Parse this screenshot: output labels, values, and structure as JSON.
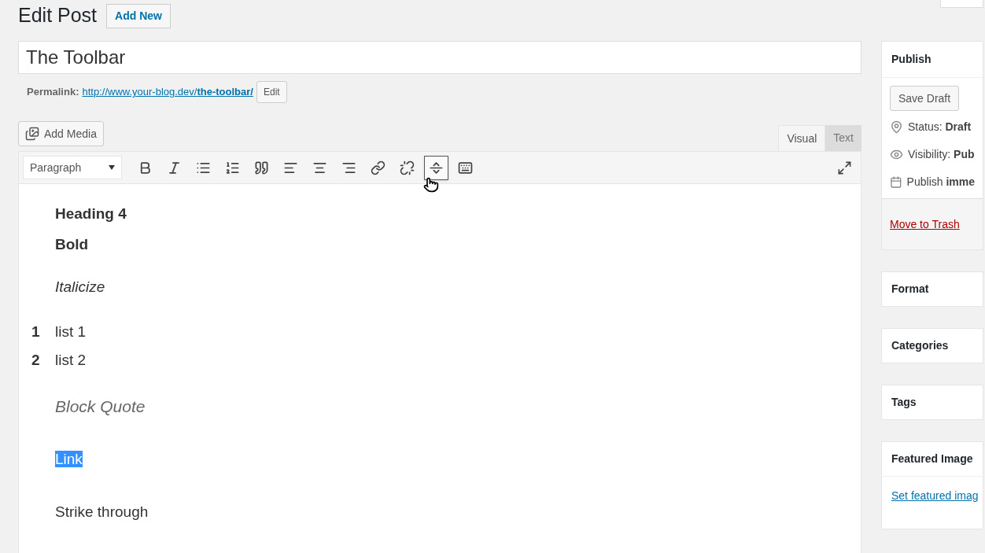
{
  "header": {
    "title": "Edit Post",
    "add_new": "Add New"
  },
  "post_title": "The Toolbar",
  "permalink": {
    "label": "Permalink:",
    "url_base": "http://www.your-blog.dev/",
    "slug": "the-toolbar/",
    "edit": "Edit"
  },
  "add_media": "Add Media",
  "editor_tabs": [
    {
      "label": "Visual",
      "selected": true
    },
    {
      "label": "Text",
      "selected": false
    }
  ],
  "format_select": "Paragraph",
  "toolbar_buttons": [
    {
      "kind": "bold",
      "selected": false
    },
    {
      "kind": "italic",
      "selected": false
    },
    {
      "kind": "bullets",
      "selected": false
    },
    {
      "kind": "numbers",
      "selected": false
    },
    {
      "kind": "quote",
      "selected": false
    },
    {
      "kind": "align-left",
      "selected": false
    },
    {
      "kind": "align-center",
      "selected": false
    },
    {
      "kind": "align-right",
      "selected": false
    },
    {
      "kind": "link",
      "selected": false
    },
    {
      "kind": "unlink",
      "selected": false
    },
    {
      "kind": "more",
      "selected": true
    },
    {
      "kind": "toolbar-toggle",
      "selected": false
    }
  ],
  "content": [
    {
      "kind": "heading",
      "text": "Heading 4"
    },
    {
      "kind": "bold",
      "text": "Bold"
    },
    {
      "kind": "italic",
      "text": "Italicize"
    },
    {
      "kind": "list",
      "items": [
        {
          "number": "1",
          "text": "list 1"
        },
        {
          "number": "2",
          "text": "list 2"
        }
      ]
    },
    {
      "kind": "quote",
      "text": "Block Quote"
    },
    {
      "kind": "selected",
      "text": "Link"
    },
    {
      "kind": "plain",
      "text": "Strike through"
    }
  ],
  "sidebar": {
    "publish": {
      "title": "Publish",
      "save_draft": "Save Draft",
      "rows": [
        {
          "kind": "status",
          "text": "Status: **Draft**"
        },
        {
          "kind": "visibility",
          "text": "Visibility: **Pub**"
        },
        {
          "kind": "schedule",
          "text": "Publish **imme**"
        }
      ],
      "trash": "Move to Trash"
    },
    "boxes": [
      {
        "title": "Format"
      },
      {
        "title": "Categories"
      },
      {
        "title": "Tags"
      },
      {
        "title": "Featured Image",
        "link": "Set featured imag"
      }
    ]
  }
}
